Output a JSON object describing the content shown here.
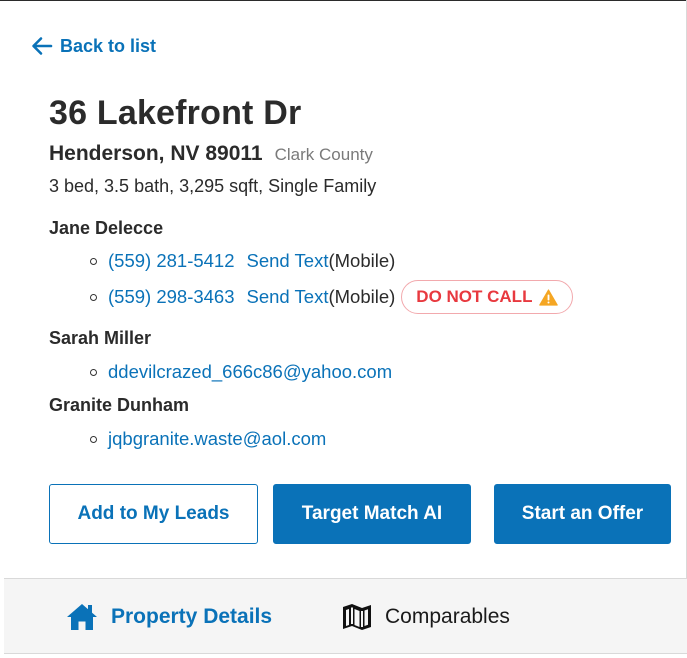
{
  "nav": {
    "back_label": "Back to list"
  },
  "property": {
    "address": "36 Lakefront Dr",
    "city_state_zip": "Henderson, NV 89011",
    "county": "Clark County",
    "facts": "3 bed, 3.5 bath, 3,295 sqft, Single Family"
  },
  "owners": [
    {
      "name": "Jane Delecce",
      "contacts": [
        {
          "phone": "(559) 281-5412",
          "action": "Send Text",
          "type": "(Mobile)"
        },
        {
          "phone": "(559) 298-3463",
          "action": "Send Text",
          "type": "(Mobile)",
          "flag": "DO NOT CALL",
          "flag_icon": "warning-icon"
        }
      ]
    },
    {
      "name": "Sarah Miller",
      "contacts": [
        {
          "email": "ddevilcrazed_666c86@yahoo.com"
        }
      ]
    },
    {
      "name": "Granite Dunham",
      "contacts": [
        {
          "email": "jqbgranite.waste@aol.com"
        }
      ]
    }
  ],
  "actions": {
    "add_leads": "Add to My Leads",
    "target_match": "Target Match AI",
    "start_offer": "Start an Offer"
  },
  "tabs": [
    {
      "label": "Property Details",
      "icon": "house-icon",
      "active": true
    },
    {
      "label": "Comparables",
      "icon": "map-icon",
      "active": false
    }
  ],
  "colors": {
    "accent": "#0a72b8",
    "danger": "#e8393f",
    "warning": "#f5a623"
  }
}
